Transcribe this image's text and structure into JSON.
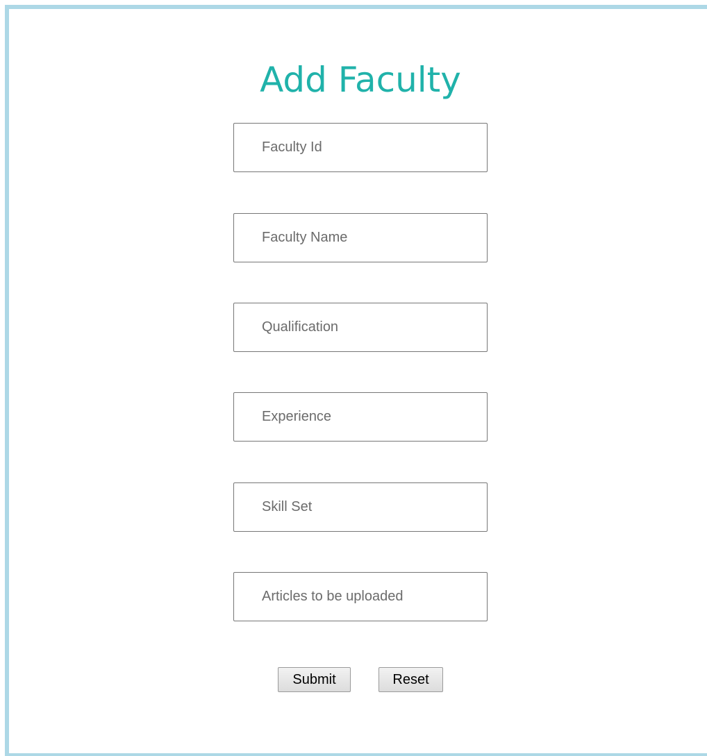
{
  "form": {
    "title": "Add Faculty",
    "fields": [
      {
        "placeholder": "Faculty Id",
        "value": ""
      },
      {
        "placeholder": "Faculty Name",
        "value": ""
      },
      {
        "placeholder": "Qualification",
        "value": ""
      },
      {
        "placeholder": "Experience",
        "value": ""
      },
      {
        "placeholder": "Skill Set",
        "value": ""
      },
      {
        "placeholder": "Articles to be uploaded",
        "value": ""
      }
    ],
    "submit_label": "Submit",
    "reset_label": "Reset"
  },
  "colors": {
    "frame_border": "#add8e6",
    "title": "#20b2aa"
  }
}
